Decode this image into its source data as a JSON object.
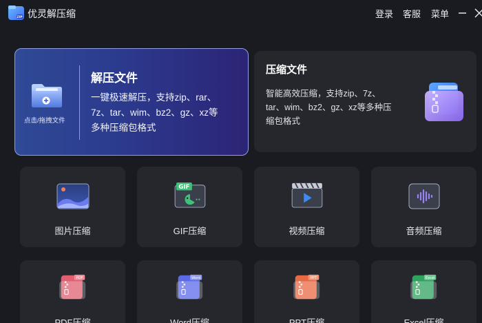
{
  "app": {
    "title": "优灵解压缩",
    "logo_icon": "zip-folder-icon"
  },
  "header": {
    "login": "登录",
    "service": "客服",
    "menu": "菜单",
    "minimize_icon": "minimize-icon",
    "close_icon": "close-icon"
  },
  "extract_card": {
    "drop_label": "点击/拖拽文件",
    "title": "解压文件",
    "desc_line1": "一键极速解压，支持zip、rar、",
    "desc_line2": "7z、tar、wim、bz2、gz、xz等",
    "desc_line3": "多种压缩包格式",
    "icon": "folder-add-icon"
  },
  "compress_card": {
    "title": "压缩文件",
    "desc_line1": "智能高效压缩，支持zip、7z、",
    "desc_line2": "tar、wim、bz2、gz、xz等多种压",
    "desc_line3": "缩包格式",
    "icon": "zip-archive-icon"
  },
  "tools_row1": [
    {
      "label": "图片压缩",
      "icon": "image-icon"
    },
    {
      "label": "GIF压缩",
      "icon": "gif-icon",
      "badge": "GIF"
    },
    {
      "label": "视频压缩",
      "icon": "video-play-icon"
    },
    {
      "label": "音频压缩",
      "icon": "audio-wave-icon"
    }
  ],
  "tools_row2": [
    {
      "label": "PDF压缩",
      "icon": "pdf-zip-icon",
      "badge": "PDF",
      "color": "#e06070"
    },
    {
      "label": "Word压缩",
      "icon": "word-zip-icon",
      "badge": "Word",
      "color": "#5b6be8"
    },
    {
      "label": "PPT压缩",
      "icon": "ppt-zip-icon",
      "badge": "PPT",
      "color": "#e86a45"
    },
    {
      "label": "Excel压缩",
      "icon": "excel-zip-icon",
      "badge": "Excel",
      "color": "#2fa35e"
    }
  ],
  "colors": {
    "background": "#1a1b20",
    "card": "#25272d",
    "extract_gradient_start": "#2f4a96",
    "extract_gradient_end": "#2c2475",
    "accent_purple": "#7b6ef0"
  }
}
